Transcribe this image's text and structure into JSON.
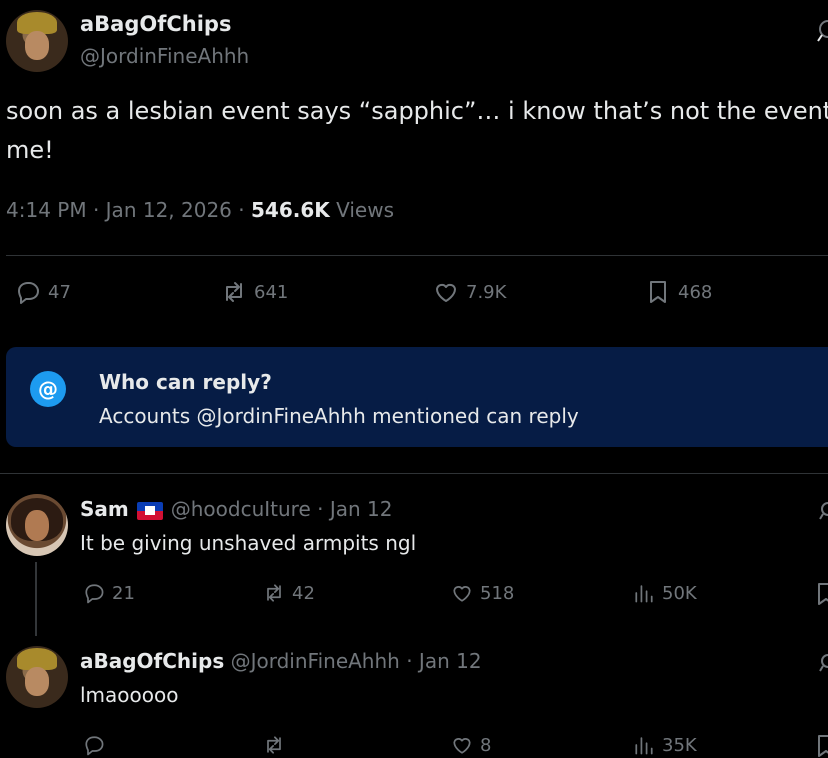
{
  "main_tweet": {
    "author_name": "aBagOfChips",
    "author_handle": "@JordinFineAhhh",
    "text_line1": "soon as a lesbian event says “sapphic”… i know that’s not the event f",
    "text_line2": "me!",
    "time": "4:14 PM · Jan 12, 2026 · ",
    "views_count": "546.6K",
    "views_label": " Views",
    "replies": "47",
    "reposts": "641",
    "likes": "7.9K",
    "bookmarks": "468"
  },
  "reply_restriction": {
    "icon_glyph": "@",
    "title": "Who can reply?",
    "subtitle": "Accounts @JordinFineAhhh mentioned can reply"
  },
  "replies": [
    {
      "author_name": "Sam",
      "author_handle": "@hoodcuIture",
      "date": " · Jan 12",
      "text": "It be giving unshaved armpits ngl",
      "replies": "21",
      "reposts": "42",
      "likes": "518",
      "views": "50K"
    },
    {
      "author_name": "aBagOfChips",
      "author_handle": "@JordinFineAhhh",
      "date": " · Jan 12",
      "text": "lmaooooo",
      "replies": "",
      "reposts": "",
      "likes": "8",
      "views": "35K"
    }
  ],
  "colors": {
    "background": "#000000",
    "text": "#e7e9ea",
    "muted": "#71767b",
    "accent": "#1d9bf0",
    "banner": "#061c45"
  }
}
